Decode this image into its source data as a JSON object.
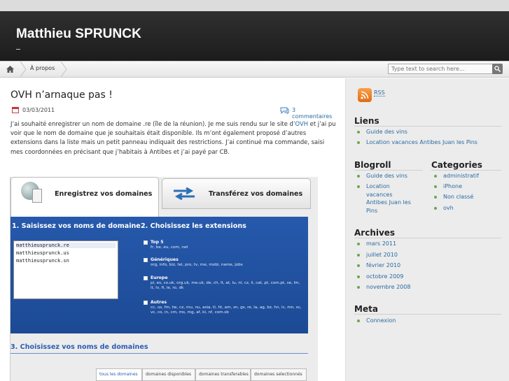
{
  "site": {
    "title": "Matthieu SPRUNCK"
  },
  "nav": {
    "items": [
      "À propos"
    ],
    "search_placeholder": "Type text to search here..."
  },
  "post": {
    "title": "OVH n’arnaque pas !",
    "date": "03/03/2011",
    "comments": "3 commentaires",
    "body_pre_link": "J’ai souhaité enregistrer un nom de domaine .re (île de la réunion). Je me suis rendu sur le site d’",
    "body_link": "OVH",
    "body_post_link": " et j’ai pu voir que le nom de domaine que je souhaitais était disponible. Ils m’ont également proposé d’autres extensions dans la liste mais un petit panneau indiquait des restrictions. J’ai continué ma commande, saisi mes coordonnées en précisant que j’habitais à Antibes et j’ai payé par CB."
  },
  "screenshot": {
    "tab1": "Enregistrez vos domaines",
    "tab2": "Transférez vos domaines",
    "step1": "1. Saisissez vos noms de domaine",
    "step2": "2. Choisissez les extensions",
    "step3": "3. Choisissez vos noms de domaines",
    "domains": [
      "matthieusprunck.re",
      "matthieusprunck.us",
      "matthieusprunck.sn"
    ],
    "ext": [
      {
        "title": "Top 5",
        "list": "fr, be, eu, com, net"
      },
      {
        "title": "Génériques",
        "list": "org, info, biz, tel, pro, tv, me, mobi, name, jobs"
      },
      {
        "title": "Europe",
        "list": "pl, es, co.uk, org.uk, me.uk, de, ch, lt, at, lu, nl, cz, li, cat, pt, com.pt, se, lm, lt, lv, fi, ie, ro, dk"
      },
      {
        "title": "Autres",
        "list": "cc, us, fm, tw, cx, mu, nu, asia, tl, ht, am, sn, gs, re, la, ag, bz, hn, lc, mn, sc, vc, co, in, cm, ms, mg, af, ki, nf, com.sb"
      }
    ],
    "subtabs": [
      "tous les domaines",
      "domaines disponibles",
      "domaines transferables",
      "domaines selectionnés"
    ]
  },
  "sidebar": {
    "rss": "RSS",
    "liens": {
      "title": "Liens",
      "items": [
        "Guide des vins",
        "Location vacances Antibes Juan les Pins"
      ]
    },
    "blogroll": {
      "title": "Blogroll",
      "items": [
        "Guide des vins",
        "Location vacances Antibes Juan les Pins"
      ]
    },
    "categories": {
      "title": "Categories",
      "items": [
        "administratif",
        "iPhone",
        "Non classé",
        "ovh"
      ]
    },
    "archives": {
      "title": "Archives",
      "items": [
        "mars 2011",
        "juillet 2010",
        "février 2010",
        "octobre 2009",
        "novembre 2008"
      ]
    },
    "meta": {
      "title": "Meta",
      "items": [
        "Connexion"
      ]
    }
  }
}
